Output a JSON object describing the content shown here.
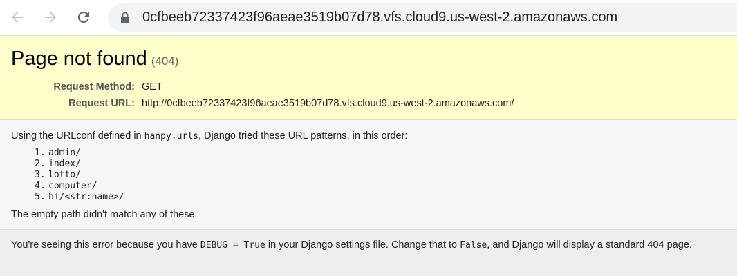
{
  "browser": {
    "url": "0cfbeeb72337423f96aeae3519b07d78.vfs.cloud9.us-west-2.amazonaws.com"
  },
  "summary": {
    "title": "Page not found",
    "status_code": "(404)",
    "request_method_label": "Request Method:",
    "request_method": "GET",
    "request_url_label": "Request URL:",
    "request_url": "http://0cfbeeb72337423f96aeae3519b07d78.vfs.cloud9.us-west-2.amazonaws.com/"
  },
  "info": {
    "intro_prefix": "Using the URLconf defined in ",
    "urlconf": "hanpy.urls",
    "intro_suffix": ", Django tried these URL patterns, in this order:",
    "patterns": [
      {
        "num": "1.",
        "pattern": "admin/"
      },
      {
        "num": "2.",
        "pattern": "index/"
      },
      {
        "num": "3.",
        "pattern": "lotto/"
      },
      {
        "num": "4.",
        "pattern": "computer/"
      },
      {
        "num": "5.",
        "pattern": "hi/<str:name>/"
      }
    ],
    "no_match": "The empty path didn't match any of these."
  },
  "explanation": {
    "part1": "You're seeing this error because you have ",
    "debug_code": "DEBUG = True",
    "part2": " in your Django settings file. Change that to ",
    "false_code": "False",
    "part3": ", and Django will display a standard 404 page."
  }
}
